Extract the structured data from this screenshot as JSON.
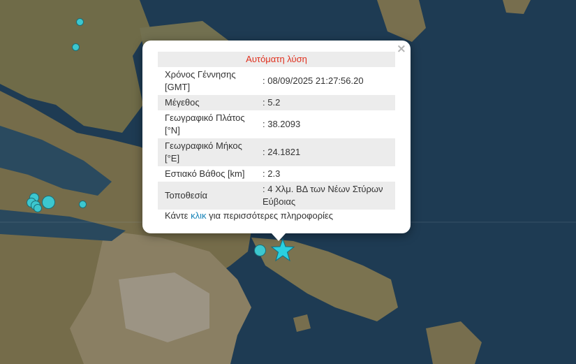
{
  "popup": {
    "title": "Αυτόματη λύση",
    "close_label": "×",
    "rows": [
      {
        "label": "Χρόνος Γέννησης [GMT]",
        "value": ": 08/09/2025 21:27:56.20"
      },
      {
        "label": "Μέγεθος",
        "value": ": 5.2"
      },
      {
        "label": "Γεωγραφικό Πλάτος [°N]",
        "value": ": 38.2093"
      },
      {
        "label": "Γεωγραφικό Μήκος [°E]",
        "value": ": 24.1821"
      },
      {
        "label": "Εστιακό Βάθος [km]",
        "value": ": 2.3"
      },
      {
        "label": "Τοποθεσία",
        "value": ": 4 Χλμ. ΒΔ των Νέων Στύρων Εύβοιας"
      }
    ],
    "footer_pre": "Κάντε ",
    "footer_link": "κλικ",
    "footer_post": " για περισσότερες πληροφορίες"
  },
  "colors": {
    "sea": "#1d3a52",
    "land": "#6b6a45",
    "quake_marker": "#3cc7cf",
    "title_red": "#e0301e",
    "link_blue": "#1583b8"
  },
  "icons": {
    "epicenter": "star-icon",
    "close": "close-icon"
  }
}
